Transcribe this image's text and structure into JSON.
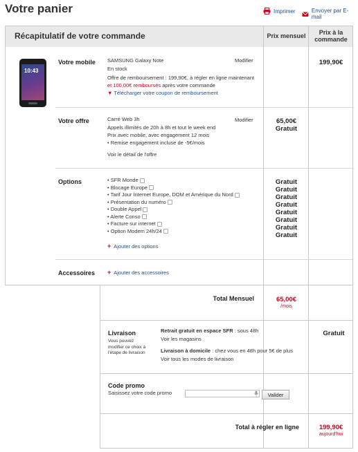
{
  "header": {
    "title": "Votre panier",
    "print_label": "Imprimer",
    "email_label": "Envoyer par E-mail"
  },
  "table": {
    "title": "Récapitulatif de votre commande",
    "col_monthly": "Prix mensuel",
    "col_order_1": "Prix à la",
    "col_order_2": "commande"
  },
  "mobile": {
    "label": "Votre mobile",
    "name": "SAMSUNG Galaxy Note",
    "stock": "En stock",
    "offer_line1": "Offre de remboursement : 199,90€, à régler en ligne maintenant",
    "offer_line2_red": "et 100,00€ remboursés",
    "offer_line2_rest": " après votre commande",
    "download_link": "Télécharger votre coupon de remboursement",
    "modify": "Modifier",
    "order_price": "199,90€",
    "screen_time": "10:43"
  },
  "offer": {
    "label": "Votre offre",
    "name": "Carré Web 3h",
    "line1": "Appels illimités de 20h à 8h et tout le week end",
    "line2": "Prix avec mobile, avec engagement 12 mois",
    "line3": "Remise engagement incluse de -5€/mois",
    "detail_link": "Voir le détail de l'offre",
    "modify": "Modifier",
    "monthly_price": "65,00€",
    "monthly_note": "Gratuit"
  },
  "options": {
    "label": "Options",
    "items": [
      "SFR Monde",
      "Blocage Europe",
      "Tarif Jour Internet Europe, DOM et Amérique du Nord",
      "Présentation du numéro",
      "Double Appel",
      "Alerte Conso",
      "Facture sur internet",
      "Option Modem 24h/24"
    ],
    "prices": [
      "Gratuit",
      "Gratuit",
      "Gratuit",
      "Gratuit",
      "Gratuit",
      "Gratuit",
      "Gratuit",
      "Gratuit"
    ],
    "add_link": "Ajouter des options"
  },
  "accessories": {
    "label": "Accessoires",
    "add_link": "Ajouter des accessoires"
  },
  "total_monthly": {
    "label": "Total Mensuel",
    "value": "65,00€",
    "unit": "/mois"
  },
  "delivery": {
    "label": "Livraison",
    "note_1": "Vous pouvez",
    "note_2": "modifier ce choix à",
    "note_3": "l'étape de livraison",
    "pickup_bold": "Retrait gratuit en espace SFR",
    "pickup_rest": " : sous 48h",
    "stores_link": "Voir les magasins",
    "home_bold": "Livraison à domicile",
    "home_rest": " : chez vous en 48h pour 5€ de plus",
    "modes_link": "Voir tous les modes de livraison",
    "price": "Gratuit"
  },
  "promo": {
    "label": "Code promo",
    "hint": "Saisissez votre code promo",
    "input_value": "",
    "validate": "Valider"
  },
  "total_online": {
    "label": "Total à régler en ligne",
    "value": "199,90€",
    "note": "aujourd'hui"
  },
  "colors": {
    "accent_red": "#d0021b",
    "link_blue": "#1f4e8c",
    "header_gray": "#e9e9e9"
  }
}
